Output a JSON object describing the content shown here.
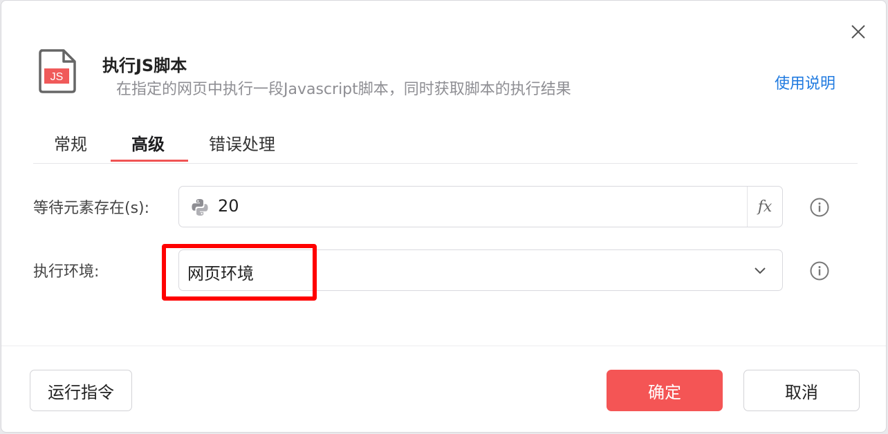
{
  "header": {
    "title": "执行JS脚本",
    "description": "在指定的网页中执行一段Javascript脚本，同时获取脚本的执行结果",
    "help_link": "使用说明",
    "file_icon_text": "JS"
  },
  "tabs": [
    {
      "label": "常规",
      "active": false
    },
    {
      "label": "高级",
      "active": true
    },
    {
      "label": "错误处理",
      "active": false
    }
  ],
  "form": {
    "wait_label": "等待元素存在(s):",
    "wait_value": "20",
    "fx_label": "fx",
    "env_label": "执行环境:",
    "env_value": "网页环境"
  },
  "footer": {
    "run_label": "运行指令",
    "confirm_label": "确定",
    "cancel_label": "取消"
  },
  "colors": {
    "accent": "#f45555",
    "link": "#1f7ae0",
    "highlight": "#ff0000"
  },
  "icons": {
    "close": "close-icon",
    "file": "js-file-icon",
    "python": "python-icon",
    "info": "info-icon",
    "chevron": "chevron-down-icon"
  }
}
